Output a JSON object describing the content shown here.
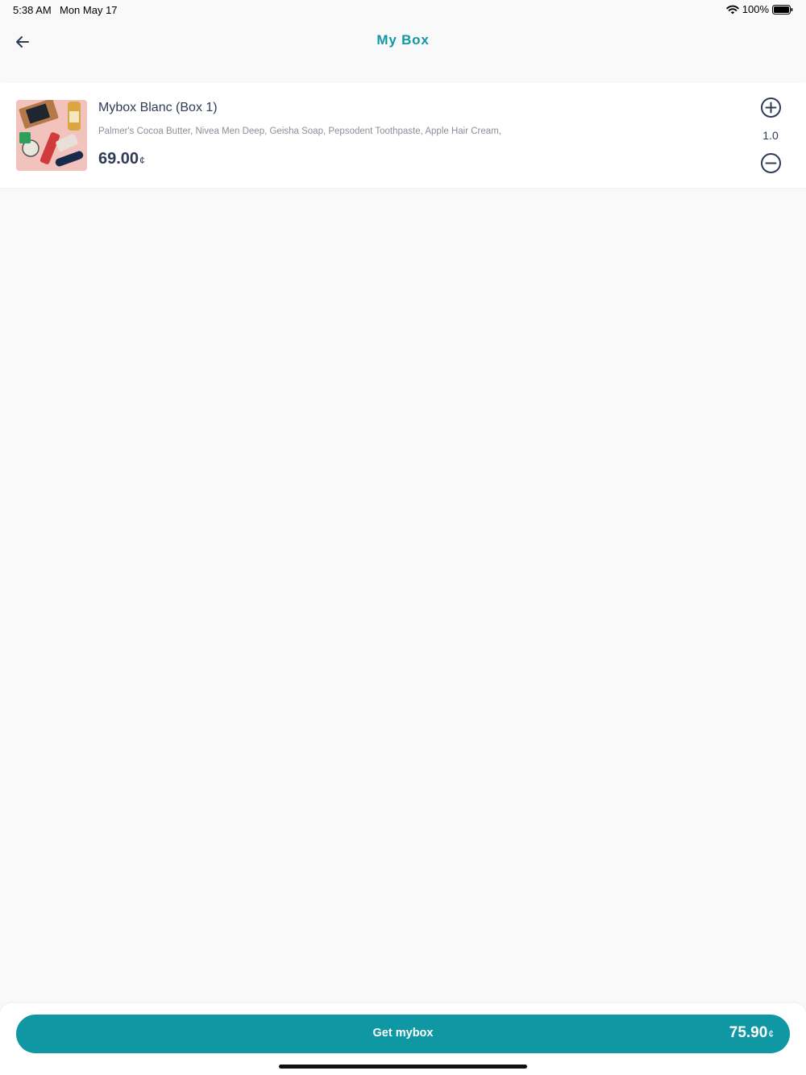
{
  "status_bar": {
    "time": "5:38 AM",
    "date": "Mon May 17",
    "battery": "100%",
    "icons": [
      "wifi-icon",
      "battery-icon"
    ]
  },
  "header": {
    "title": "My Box",
    "back_icon": "arrow-left-icon"
  },
  "cart": {
    "items": [
      {
        "name": "Mybox Blanc (Box 1)",
        "description": "Palmer's Cocoa Butter, Nivea Men Deep, Geisha Soap, Pepsodent Toothpaste, Apple Hair Cream,",
        "price": "69.00",
        "currency": "¢",
        "quantity": "1.0",
        "icons": [
          "plus-circle-icon",
          "minus-circle-icon"
        ]
      }
    ]
  },
  "checkout": {
    "label": "Get mybox",
    "total": "75.90",
    "currency": "¢"
  },
  "colors": {
    "accent": "#0f98a3",
    "text_dark": "#2e3b55",
    "text_muted": "#8a8f99",
    "background": "#f9f9f9"
  }
}
